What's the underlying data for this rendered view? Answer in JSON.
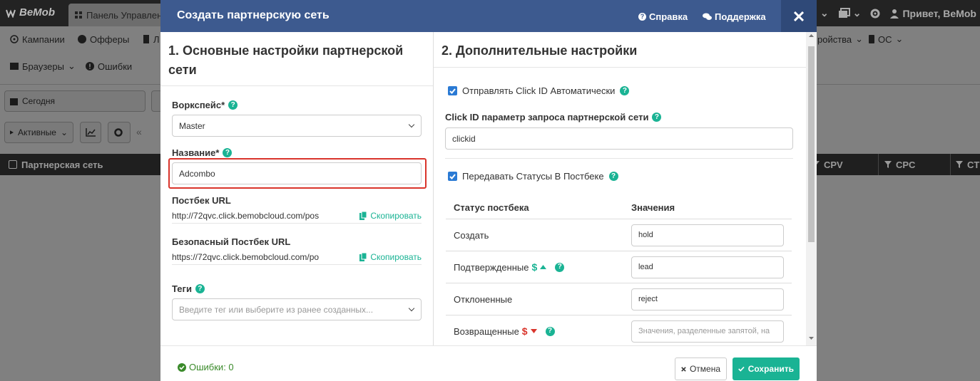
{
  "app": {
    "logo": "BeMob",
    "tab_label": "Панель Управлен",
    "greeting": "Привет, BeMob",
    "nav_row1": [
      "Кампании",
      "Офферы",
      "Л",
      "ройства",
      "ОС"
    ],
    "nav_row2": [
      "Браузеры",
      "Ошибки"
    ],
    "date_filter": "Сегодня",
    "status_filter": "Активные",
    "table_headers": [
      "Партнерская сеть",
      "CPV",
      "CPC",
      "CT"
    ]
  },
  "modal": {
    "title": "Создать партнерскую сеть",
    "help_link": "Справка",
    "support_link": "Поддержка",
    "section1": {
      "title": "1. Основные настройки партнерской сети",
      "workspace_label": "Воркспейс*",
      "workspace_value": "Master",
      "name_label": "Название*",
      "name_value": "Adcombo",
      "postback_label": "Постбек URL",
      "postback_value": "http://72qvc.click.bemobcloud.com/pos",
      "secure_postback_label": "Безопасный Постбек URL",
      "secure_postback_value": "https://72qvc.click.bemobcloud.com/po",
      "copy_label": "Скопировать",
      "tags_label": "Теги",
      "tags_placeholder": "Введите тег или выберите из ранее созданных..."
    },
    "section2": {
      "title": "2. Дополнительные настройки",
      "send_clickid_label": "Отправлять Click ID Автоматически",
      "send_clickid_checked": true,
      "clickid_param_label": "Click ID параметр запроса партнерской сети",
      "clickid_param_value": "clickid",
      "pass_statuses_label": "Передавать Статусы В Постбеке",
      "pass_statuses_checked": true,
      "status_col_header": "Статус постбека",
      "values_col_header": "Значения",
      "statuses": [
        {
          "name": "Создать",
          "value": "hold",
          "icon": ""
        },
        {
          "name": "Подтвержденные",
          "value": "lead",
          "icon": "dollar-up"
        },
        {
          "name": "Отклоненные",
          "value": "reject",
          "icon": ""
        },
        {
          "name": "Возвращенные",
          "value": "",
          "placeholder": "Значения, разделенные запятой, на",
          "icon": "dollar-down"
        }
      ]
    },
    "footer": {
      "errors_label": "Ошибки: 0",
      "cancel_label": "Отмена",
      "save_label": "Сохранить"
    },
    "colors": {
      "header": "#3d5a8f",
      "accent": "#1ab394",
      "checkbox": "#2a7ad4",
      "highlight": "#d9342b"
    }
  }
}
